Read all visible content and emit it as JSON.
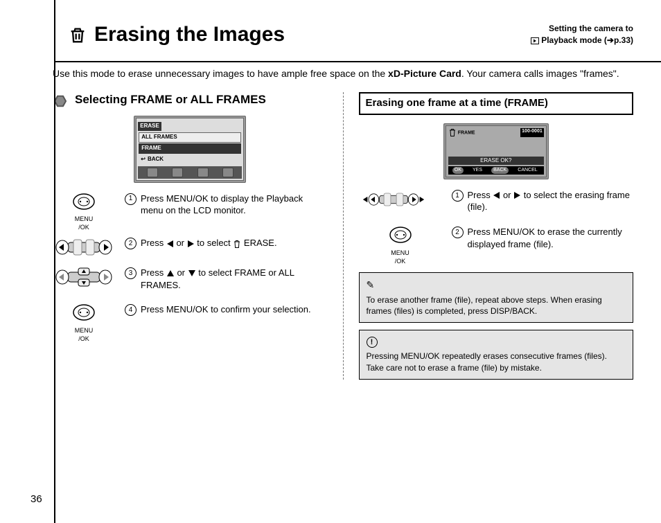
{
  "header": {
    "title": "Erasing the Images",
    "note_line1": "Setting the camera to",
    "note_line2": "Playback mode (➔p.33)"
  },
  "intro": {
    "pre": "Use this mode to erase unnecessary images to have ample free space on the ",
    "bold": "xD-Picture Card",
    "post": ". Your camera calls images \"frames\"."
  },
  "left": {
    "heading": "Selecting FRAME or ALL FRAMES",
    "lcd": {
      "title": "ERASE",
      "row1": "ALL FRAMES",
      "row2": "FRAME",
      "back": "BACK"
    },
    "steps": {
      "s1": "Press MENU/OK to display the Playback menu on the LCD monitor.",
      "s2_pre": "Press ",
      "s2_post": " to select ",
      "s2_end": " ERASE.",
      "s2_or": " or ",
      "s3_pre": "Press ",
      "s3_or": " or ",
      "s3_post": " to select FRAME or ALL FRAMES.",
      "s4": "Press MENU/OK to confirm your selection."
    },
    "ctrl_label": "MENU\n/OK"
  },
  "right": {
    "heading": "Erasing one frame at a time (FRAME)",
    "lcd": {
      "frame": "FRAME",
      "file": "100-0001",
      "ok": "ERASE OK?",
      "yes": "YES",
      "cancel": "CANCEL",
      "okbtn": "OK",
      "backbtn": "BACK"
    },
    "steps": {
      "s1_pre": "Press ",
      "s1_or": " or ",
      "s1_post": " to select the erasing frame (file).",
      "s2": "Press MENU/OK to erase the currently displayed frame (file)."
    },
    "note": "To erase another frame (file), repeat above steps. When erasing frames (files) is completed, press DISP/BACK.",
    "caution": "Pressing MENU/OK repeatedly erases consecutive frames (files). Take care not to erase a frame (file) by mistake."
  },
  "page_num": "36"
}
